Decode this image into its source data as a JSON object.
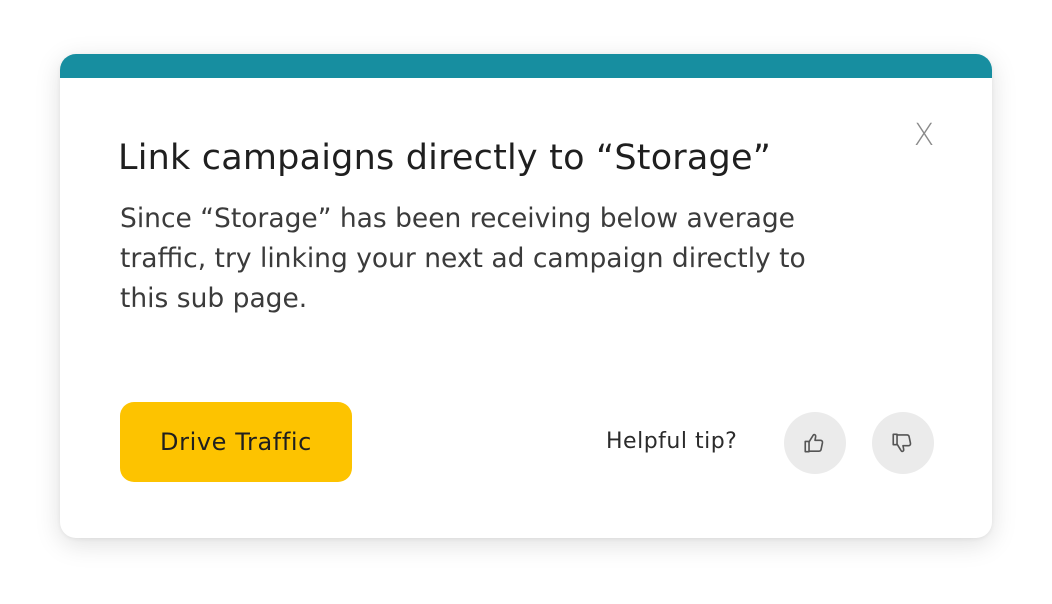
{
  "card": {
    "accent_color": "#178ea0",
    "close_label": "X",
    "title": "Link campaigns directly to “Storage”",
    "body": "Since “Storage” has been receiving below average traffic, try linking your next ad campaign directly to this sub page.",
    "cta_label": "Drive Traffic",
    "cta_color": "#fdc300",
    "feedback": {
      "prompt": "Helpful tip?",
      "up_icon": "thumbs-up-icon",
      "down_icon": "thumbs-down-icon"
    }
  }
}
